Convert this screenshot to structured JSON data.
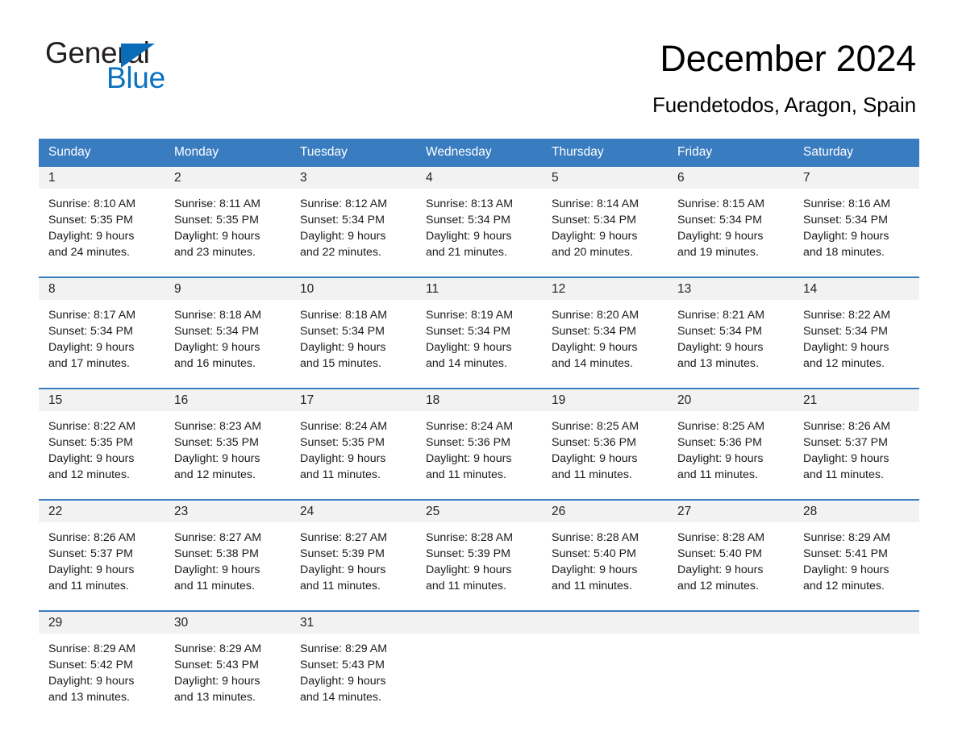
{
  "logo": {
    "word_one": "General",
    "word_two": "Blue",
    "triangle_color": "#0a6cb7",
    "blue_text_color": "#0a72c0"
  },
  "header": {
    "month_title": "December 2024",
    "location": "Fuendetodos, Aragon, Spain"
  },
  "theme": {
    "header_blue": "#3a7cc0",
    "day_strip_gray": "#f2f2f2",
    "text_dark": "#1a1a1a"
  },
  "weekdays": [
    "Sunday",
    "Monday",
    "Tuesday",
    "Wednesday",
    "Thursday",
    "Friday",
    "Saturday"
  ],
  "weeks": [
    [
      {
        "day": "1",
        "sunrise": "Sunrise: 8:10 AM",
        "sunset": "Sunset: 5:35 PM",
        "daylight_1": "Daylight: 9 hours",
        "daylight_2": "and 24 minutes."
      },
      {
        "day": "2",
        "sunrise": "Sunrise: 8:11 AM",
        "sunset": "Sunset: 5:35 PM",
        "daylight_1": "Daylight: 9 hours",
        "daylight_2": "and 23 minutes."
      },
      {
        "day": "3",
        "sunrise": "Sunrise: 8:12 AM",
        "sunset": "Sunset: 5:34 PM",
        "daylight_1": "Daylight: 9 hours",
        "daylight_2": "and 22 minutes."
      },
      {
        "day": "4",
        "sunrise": "Sunrise: 8:13 AM",
        "sunset": "Sunset: 5:34 PM",
        "daylight_1": "Daylight: 9 hours",
        "daylight_2": "and 21 minutes."
      },
      {
        "day": "5",
        "sunrise": "Sunrise: 8:14 AM",
        "sunset": "Sunset: 5:34 PM",
        "daylight_1": "Daylight: 9 hours",
        "daylight_2": "and 20 minutes."
      },
      {
        "day": "6",
        "sunrise": "Sunrise: 8:15 AM",
        "sunset": "Sunset: 5:34 PM",
        "daylight_1": "Daylight: 9 hours",
        "daylight_2": "and 19 minutes."
      },
      {
        "day": "7",
        "sunrise": "Sunrise: 8:16 AM",
        "sunset": "Sunset: 5:34 PM",
        "daylight_1": "Daylight: 9 hours",
        "daylight_2": "and 18 minutes."
      }
    ],
    [
      {
        "day": "8",
        "sunrise": "Sunrise: 8:17 AM",
        "sunset": "Sunset: 5:34 PM",
        "daylight_1": "Daylight: 9 hours",
        "daylight_2": "and 17 minutes."
      },
      {
        "day": "9",
        "sunrise": "Sunrise: 8:18 AM",
        "sunset": "Sunset: 5:34 PM",
        "daylight_1": "Daylight: 9 hours",
        "daylight_2": "and 16 minutes."
      },
      {
        "day": "10",
        "sunrise": "Sunrise: 8:18 AM",
        "sunset": "Sunset: 5:34 PM",
        "daylight_1": "Daylight: 9 hours",
        "daylight_2": "and 15 minutes."
      },
      {
        "day": "11",
        "sunrise": "Sunrise: 8:19 AM",
        "sunset": "Sunset: 5:34 PM",
        "daylight_1": "Daylight: 9 hours",
        "daylight_2": "and 14 minutes."
      },
      {
        "day": "12",
        "sunrise": "Sunrise: 8:20 AM",
        "sunset": "Sunset: 5:34 PM",
        "daylight_1": "Daylight: 9 hours",
        "daylight_2": "and 14 minutes."
      },
      {
        "day": "13",
        "sunrise": "Sunrise: 8:21 AM",
        "sunset": "Sunset: 5:34 PM",
        "daylight_1": "Daylight: 9 hours",
        "daylight_2": "and 13 minutes."
      },
      {
        "day": "14",
        "sunrise": "Sunrise: 8:22 AM",
        "sunset": "Sunset: 5:34 PM",
        "daylight_1": "Daylight: 9 hours",
        "daylight_2": "and 12 minutes."
      }
    ],
    [
      {
        "day": "15",
        "sunrise": "Sunrise: 8:22 AM",
        "sunset": "Sunset: 5:35 PM",
        "daylight_1": "Daylight: 9 hours",
        "daylight_2": "and 12 minutes."
      },
      {
        "day": "16",
        "sunrise": "Sunrise: 8:23 AM",
        "sunset": "Sunset: 5:35 PM",
        "daylight_1": "Daylight: 9 hours",
        "daylight_2": "and 12 minutes."
      },
      {
        "day": "17",
        "sunrise": "Sunrise: 8:24 AM",
        "sunset": "Sunset: 5:35 PM",
        "daylight_1": "Daylight: 9 hours",
        "daylight_2": "and 11 minutes."
      },
      {
        "day": "18",
        "sunrise": "Sunrise: 8:24 AM",
        "sunset": "Sunset: 5:36 PM",
        "daylight_1": "Daylight: 9 hours",
        "daylight_2": "and 11 minutes."
      },
      {
        "day": "19",
        "sunrise": "Sunrise: 8:25 AM",
        "sunset": "Sunset: 5:36 PM",
        "daylight_1": "Daylight: 9 hours",
        "daylight_2": "and 11 minutes."
      },
      {
        "day": "20",
        "sunrise": "Sunrise: 8:25 AM",
        "sunset": "Sunset: 5:36 PM",
        "daylight_1": "Daylight: 9 hours",
        "daylight_2": "and 11 minutes."
      },
      {
        "day": "21",
        "sunrise": "Sunrise: 8:26 AM",
        "sunset": "Sunset: 5:37 PM",
        "daylight_1": "Daylight: 9 hours",
        "daylight_2": "and 11 minutes."
      }
    ],
    [
      {
        "day": "22",
        "sunrise": "Sunrise: 8:26 AM",
        "sunset": "Sunset: 5:37 PM",
        "daylight_1": "Daylight: 9 hours",
        "daylight_2": "and 11 minutes."
      },
      {
        "day": "23",
        "sunrise": "Sunrise: 8:27 AM",
        "sunset": "Sunset: 5:38 PM",
        "daylight_1": "Daylight: 9 hours",
        "daylight_2": "and 11 minutes."
      },
      {
        "day": "24",
        "sunrise": "Sunrise: 8:27 AM",
        "sunset": "Sunset: 5:39 PM",
        "daylight_1": "Daylight: 9 hours",
        "daylight_2": "and 11 minutes."
      },
      {
        "day": "25",
        "sunrise": "Sunrise: 8:28 AM",
        "sunset": "Sunset: 5:39 PM",
        "daylight_1": "Daylight: 9 hours",
        "daylight_2": "and 11 minutes."
      },
      {
        "day": "26",
        "sunrise": "Sunrise: 8:28 AM",
        "sunset": "Sunset: 5:40 PM",
        "daylight_1": "Daylight: 9 hours",
        "daylight_2": "and 11 minutes."
      },
      {
        "day": "27",
        "sunrise": "Sunrise: 8:28 AM",
        "sunset": "Sunset: 5:40 PM",
        "daylight_1": "Daylight: 9 hours",
        "daylight_2": "and 12 minutes."
      },
      {
        "day": "28",
        "sunrise": "Sunrise: 8:29 AM",
        "sunset": "Sunset: 5:41 PM",
        "daylight_1": "Daylight: 9 hours",
        "daylight_2": "and 12 minutes."
      }
    ],
    [
      {
        "day": "29",
        "sunrise": "Sunrise: 8:29 AM",
        "sunset": "Sunset: 5:42 PM",
        "daylight_1": "Daylight: 9 hours",
        "daylight_2": "and 13 minutes."
      },
      {
        "day": "30",
        "sunrise": "Sunrise: 8:29 AM",
        "sunset": "Sunset: 5:43 PM",
        "daylight_1": "Daylight: 9 hours",
        "daylight_2": "and 13 minutes."
      },
      {
        "day": "31",
        "sunrise": "Sunrise: 8:29 AM",
        "sunset": "Sunset: 5:43 PM",
        "daylight_1": "Daylight: 9 hours",
        "daylight_2": "and 14 minutes."
      },
      {
        "day": "",
        "sunrise": "",
        "sunset": "",
        "daylight_1": "",
        "daylight_2": ""
      },
      {
        "day": "",
        "sunrise": "",
        "sunset": "",
        "daylight_1": "",
        "daylight_2": ""
      },
      {
        "day": "",
        "sunrise": "",
        "sunset": "",
        "daylight_1": "",
        "daylight_2": ""
      },
      {
        "day": "",
        "sunrise": "",
        "sunset": "",
        "daylight_1": "",
        "daylight_2": ""
      }
    ]
  ]
}
